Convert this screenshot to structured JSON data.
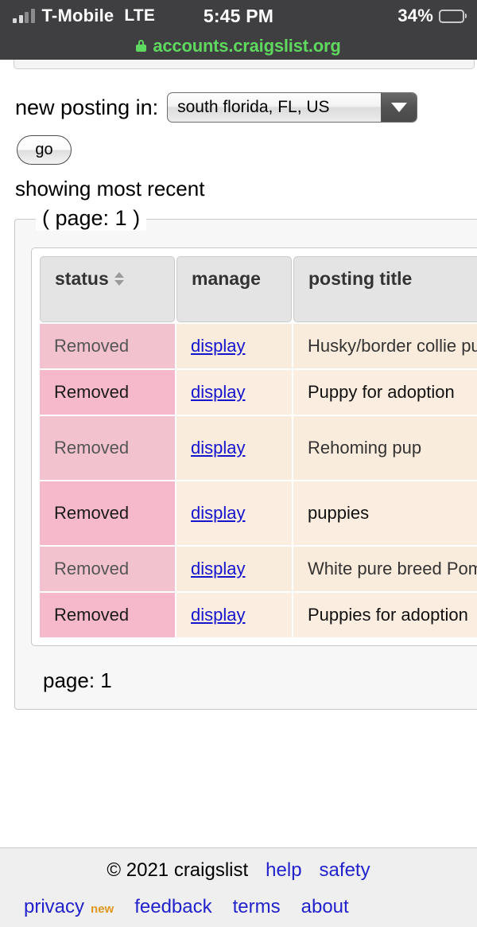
{
  "status_bar": {
    "carrier": "T-Mobile",
    "network": "LTE",
    "time": "5:45 PM",
    "battery_percent": "34%",
    "battery_level": 34,
    "battery_color": "#f2cb30",
    "signal_bars_filled": 2,
    "signal_bars_total": 4
  },
  "browser": {
    "lock_icon": "lock-icon",
    "url": "accounts.craigslist.org",
    "url_color": "#5fd85f"
  },
  "form": {
    "new_posting_label": "new posting in:",
    "location_select_value": "south florida, FL, US",
    "location_select_caret": "chevron-down-icon",
    "go_label": "go",
    "showing_text": "showing most recent"
  },
  "results": {
    "legend": "( page: 1 )",
    "page_footer": "page: 1",
    "sort_icon": "sort-updown-icon",
    "columns": [
      "status",
      "manage",
      "posting title"
    ],
    "rows": [
      {
        "status": "Removed",
        "manage": "display",
        "title": "Husky/border collie puppies"
      },
      {
        "status": "Removed",
        "manage": "display",
        "title": "Puppy for adoption"
      },
      {
        "status": "Removed",
        "manage": "display",
        "title": "Rehoming pup"
      },
      {
        "status": "Removed",
        "manage": "display",
        "title": "puppies"
      },
      {
        "status": "Removed",
        "manage": "display",
        "title": "White pure breed Pomeranian"
      },
      {
        "status": "Removed",
        "manage": "display",
        "title": "Puppies for adoption"
      }
    ]
  },
  "footer": {
    "copyright": "© 2021 craigslist",
    "links_row1": [
      "help",
      "safety"
    ],
    "links_row2": [
      "privacy",
      "feedback",
      "terms",
      "about"
    ],
    "new_badge": "new",
    "new_badge_color": "#e0971e",
    "link_color": "#2222cc"
  },
  "colors": {
    "status_cell": "#f2c3cf",
    "data_cell": "#faecdc",
    "header_cell": "#e4e4e4",
    "chrome": "#3f3f41"
  }
}
